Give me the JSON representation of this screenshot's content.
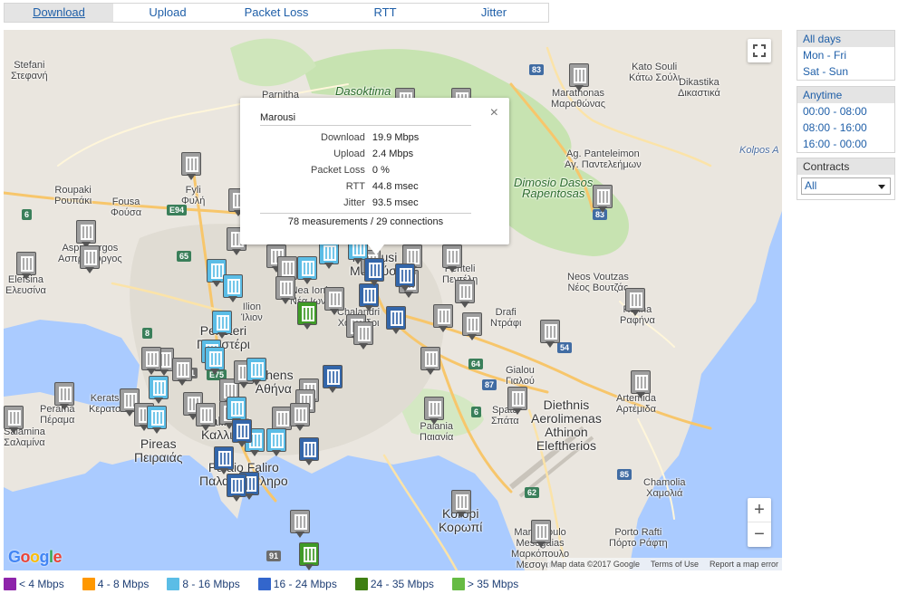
{
  "tabs": [
    "Download",
    "Upload",
    "Packet Loss",
    "RTT",
    "Jitter"
  ],
  "active_tab": "Download",
  "filters": {
    "days": {
      "selected": "All days",
      "options": [
        "Mon - Fri",
        "Sat - Sun"
      ]
    },
    "time": {
      "selected": "Anytime",
      "options": [
        "00:00 - 08:00",
        "08:00 - 16:00",
        "16:00 - 00:00"
      ]
    },
    "contracts": {
      "label": "Contracts",
      "value": "All"
    }
  },
  "popup": {
    "title": "Marousi",
    "rows": [
      {
        "k": "Download",
        "v": "19.9 Mbps"
      },
      {
        "k": "Upload",
        "v": "2.4 Mbps"
      },
      {
        "k": "Packet Loss",
        "v": "0 %"
      },
      {
        "k": "RTT",
        "v": "44.8 msec"
      },
      {
        "k": "Jitter",
        "v": "93.5 msec"
      }
    ],
    "measurements": "78 measurements / 29 connections",
    "close_icon": "×"
  },
  "map": {
    "labels": [
      "Stefani\nΣτεφανή",
      "Parnitha",
      "Dasoktima",
      "Kato Souli\nΚάτω Σούλι",
      "Marathonas\nΜαραθώνας",
      "Dikastika\nΔικαστικά",
      "Ag. Panteleimon\nΑγ. Παντελεήμων",
      "Fyli\nΦυλή",
      "Roupaki\nΡουπάκι",
      "Fousa\nΦούσα",
      "Aspropyrgos\nΑσπρόπυργος",
      "Elefsina\nΕλευσίνα",
      "Dimosio Dasos\nRapentosas",
      "Marousi\nΜαρούσι",
      "Penteli\nΠεντέλη",
      "Neos Voutzas\nΝέος Βουτζάς",
      "Rafina\nΡαφήνα",
      "Drafi\nΝτράφι",
      "Peristeri\nΠεριστέρι",
      "Ilion\nΊλιον",
      "Nea Ionia\nΝέα Ιωνία",
      "Chalandri\nΧαλάνδρι",
      "Athens\nΑθήνα",
      "Keratsini\nΚερατσίνι",
      "Perama\nΠέραμα",
      "Salamina\nΣαλαμίνα",
      "Pireas\nΠειραιάς",
      "Kallithea\nΚαλλιθέα",
      "Palaio Faliro\nΠαλαιό Φάληρο",
      "Gialou\nΓιαλού",
      "Spata\nΣπάτα",
      "Diethnis\nAerolimenas\nAthinon\nEleftherios",
      "Paiania\nΠαιανία",
      "Artemida\nΑρτέμιδα",
      "Chamolia\nΧαμολιά",
      "Koropi\nΚορωπί",
      "Markopoulo\nMesogaias\nΜαρκόπουλο\nΜεσογαίας",
      "Porto Rafti\nΠόρτο Ράφτη",
      "Kolpos A"
    ],
    "roads": [
      "83",
      "E94",
      "6",
      "65",
      "8",
      "E75",
      "1",
      "64",
      "87",
      "54",
      "6",
      "62",
      "63",
      "85",
      "91",
      "83"
    ],
    "google_logo": "Google",
    "attribution": [
      "Map data ©2017 Google",
      "Terms of Use",
      "Report a map error"
    ],
    "zoom_in": "+",
    "zoom_out": "−"
  },
  "markers": {
    "grey": 0,
    "light": 0,
    "blue": 0,
    "green": 0
  },
  "legend": [
    {
      "label": "< 4 Mbps",
      "color": "#8e24aa"
    },
    {
      "label": "4 - 8 Mbps",
      "color": "#ff9800"
    },
    {
      "label": "8 - 16 Mbps",
      "color": "#5bbde6"
    },
    {
      "label": "16 - 24 Mbps",
      "color": "#3366cc"
    },
    {
      "label": "24 - 35 Mbps",
      "color": "#3f7f13"
    },
    {
      "label": "> 35 Mbps",
      "color": "#66bb44"
    }
  ]
}
